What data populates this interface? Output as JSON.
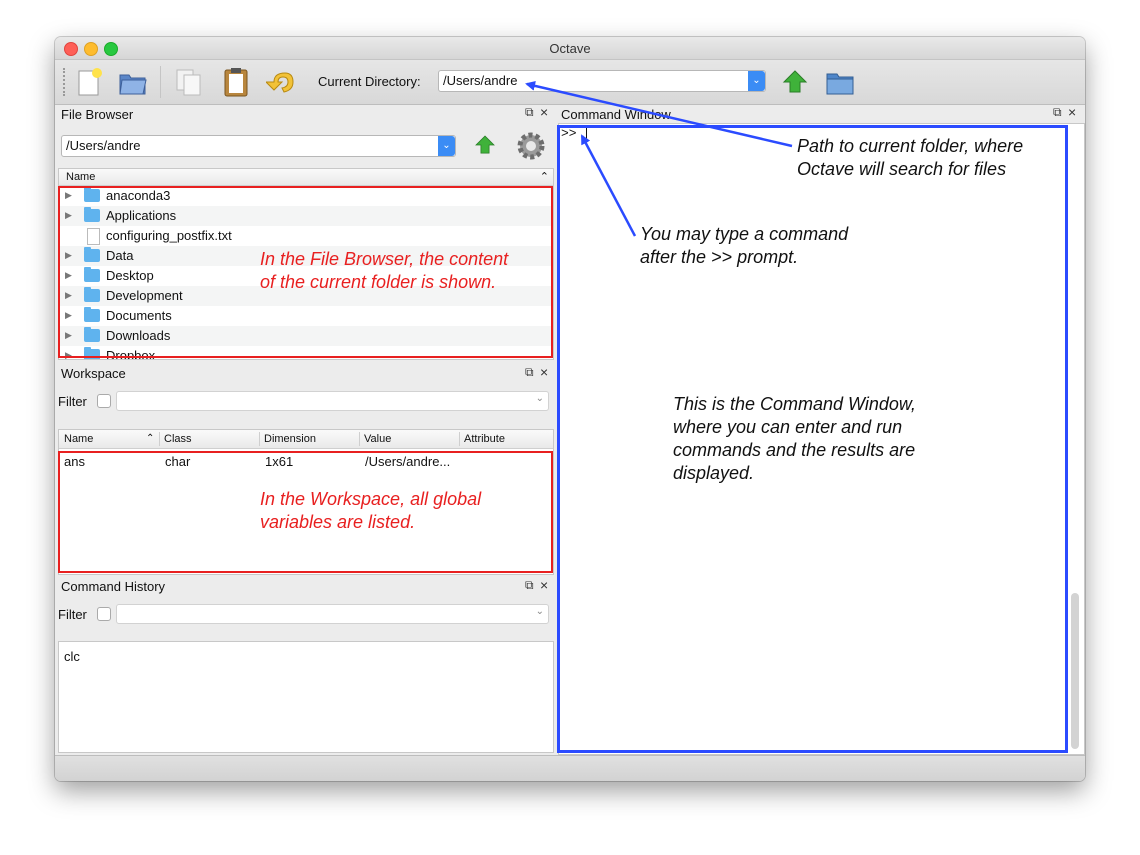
{
  "window": {
    "title": "Octave"
  },
  "toolbar": {
    "current_directory_label": "Current Directory:",
    "current_directory_value": "/Users/andre",
    "icons": [
      "new-script-icon",
      "open-folder-icon",
      "copy-icon",
      "paste-icon",
      "undo-icon",
      "go-up-icon",
      "browse-folder-icon"
    ]
  },
  "file_browser": {
    "title": "File Browser",
    "path": "/Users/andre",
    "column_name": "Name",
    "items": [
      {
        "label": "anaconda3",
        "icon": "folder",
        "expandable": true
      },
      {
        "label": "Applications",
        "icon": "applications-folder",
        "expandable": true
      },
      {
        "label": "configuring_postfix.txt",
        "icon": "text-file",
        "expandable": false
      },
      {
        "label": "Data",
        "icon": "folder",
        "expandable": true
      },
      {
        "label": "Desktop",
        "icon": "desktop-folder",
        "expandable": true
      },
      {
        "label": "Development",
        "icon": "folder",
        "expandable": true
      },
      {
        "label": "Documents",
        "icon": "documents-folder",
        "expandable": true
      },
      {
        "label": "Downloads",
        "icon": "downloads-folder",
        "expandable": true
      },
      {
        "label": "Dropbox",
        "icon": "folder",
        "expandable": true
      }
    ],
    "annotation": [
      "In the File Browser, the content",
      "of the current folder is shown."
    ]
  },
  "workspace": {
    "title": "Workspace",
    "filter_label": "Filter",
    "columns": [
      "Name",
      "Class",
      "Dimension",
      "Value",
      "Attribute"
    ],
    "rows": [
      {
        "name": "ans",
        "class": "char",
        "dimension": "1x61",
        "value": "/Users/andre...",
        "attribute": ""
      }
    ],
    "annotation": [
      "In the Workspace, all global",
      "variables are listed."
    ]
  },
  "command_history": {
    "title": "Command History",
    "filter_label": "Filter",
    "entries": [
      "clc"
    ]
  },
  "command_window": {
    "title": "Command Window",
    "prompt": ">>",
    "annotation_path": [
      "Path to current folder, where",
      "Octave will search for files"
    ],
    "annotation_prompt": [
      "You may type a command",
      "after the >> prompt."
    ],
    "annotation_window": [
      "This is the Command Window,",
      "where you can enter and run",
      "commands and the results are",
      "displayed."
    ]
  },
  "colors": {
    "annotation_red": "#e82020",
    "annotation_blue": "#2b4bff",
    "accent": "#3b8cf5"
  }
}
